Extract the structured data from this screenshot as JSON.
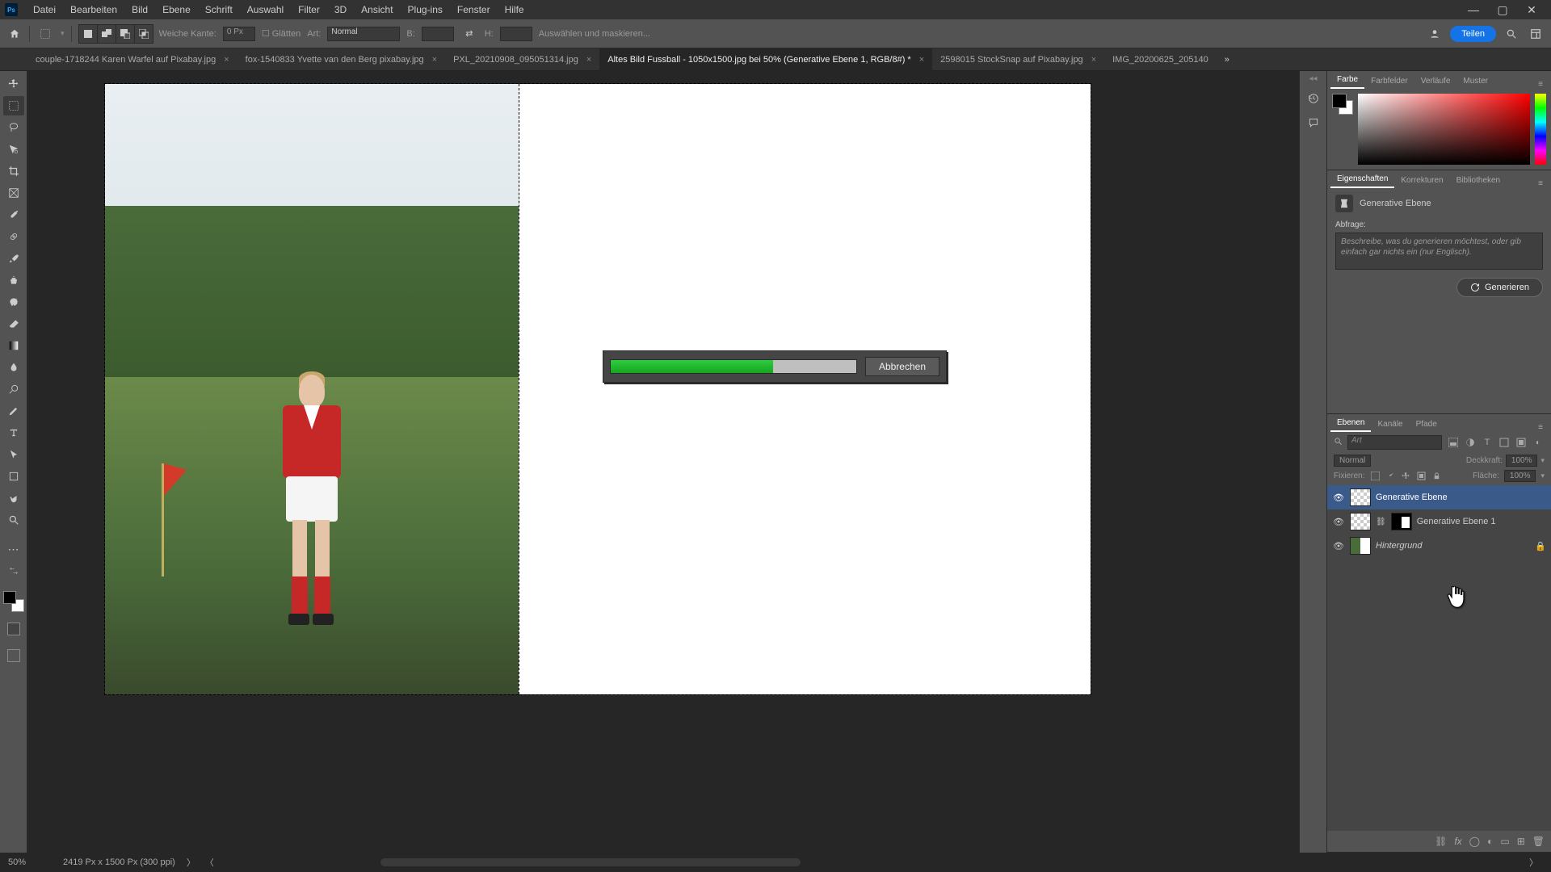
{
  "menu": {
    "items": [
      "Datei",
      "Bearbeiten",
      "Bild",
      "Ebene",
      "Schrift",
      "Auswahl",
      "Filter",
      "3D",
      "Ansicht",
      "Plug-ins",
      "Fenster",
      "Hilfe"
    ]
  },
  "optbar": {
    "weiche_kante_label": "Weiche Kante:",
    "weiche_kante_value": "0 Px",
    "glaetten": "Glätten",
    "art_label": "Art:",
    "art_value": "Normal",
    "b_label": "B:",
    "h_label": "H:",
    "refine": "Auswählen und maskieren...",
    "share": "Teilen"
  },
  "tabs": [
    {
      "label": "couple-1718244 Karen Warfel auf Pixabay.jpg",
      "active": false
    },
    {
      "label": "fox-1540833 Yvette van den Berg pixabay.jpg",
      "active": false
    },
    {
      "label": "PXL_20210908_095051314.jpg",
      "active": false
    },
    {
      "label": "Altes Bild Fussball - 1050x1500.jpg bei 50% (Generative Ebene 1, RGB/8#) *",
      "active": true
    },
    {
      "label": "2598015 StockSnap auf Pixabay.jpg",
      "active": false
    },
    {
      "label": "IMG_20200625_205140",
      "active": false
    }
  ],
  "progress": {
    "percent": 66,
    "cancel": "Abbrechen"
  },
  "panels": {
    "color_tabs": [
      "Farbe",
      "Farbfelder",
      "Verläufe",
      "Muster"
    ],
    "props_tabs": [
      "Eigenschaften",
      "Korrekturen",
      "Bibliotheken"
    ],
    "layers_tabs": [
      "Ebenen",
      "Kanäle",
      "Pfade"
    ]
  },
  "properties": {
    "kind": "Generative Ebene",
    "query_label": "Abfrage:",
    "placeholder": "Beschreibe, was du generieren möchtest, oder gib einfach gar nichts ein (nur Englisch).",
    "generate": "Generieren"
  },
  "layers": {
    "search_placeholder": "Art",
    "blend": "Normal",
    "opacity_label": "Deckkraft:",
    "opacity_value": "100%",
    "lock_label": "Fixieren:",
    "fill_label": "Fläche:",
    "fill_value": "100%",
    "items": [
      {
        "name": "Generative Ebene",
        "selected": true,
        "locked": false,
        "type": "gen"
      },
      {
        "name": "Generative Ebene 1",
        "selected": false,
        "locked": false,
        "type": "gen-mask"
      },
      {
        "name": "Hintergrund",
        "selected": false,
        "locked": true,
        "type": "bg",
        "italic": true
      }
    ]
  },
  "status": {
    "zoom": "50%",
    "docinfo": "2419 Px x 1500 Px (300 ppi)"
  },
  "colors": {
    "accent": "#1473e6",
    "progress": "#2ecc40"
  }
}
